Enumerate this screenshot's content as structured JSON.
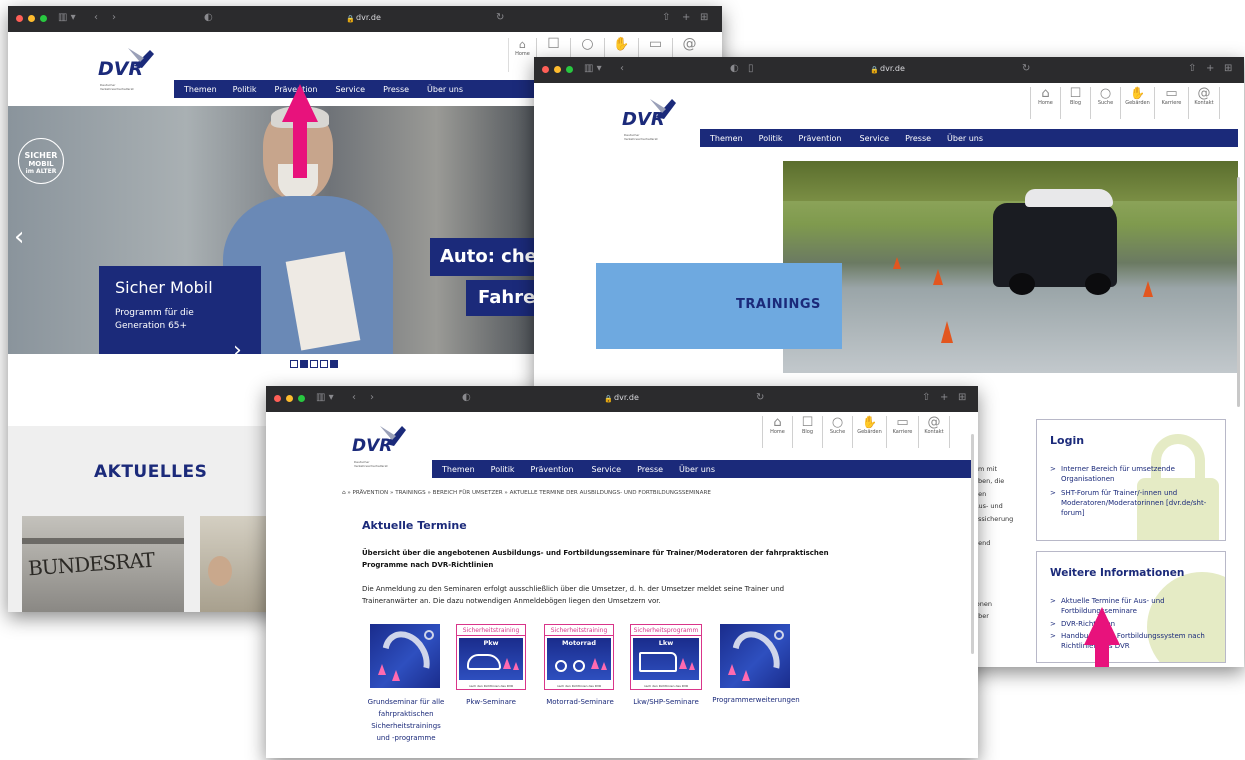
{
  "browser": {
    "url": "dvr.de"
  },
  "logo": {
    "text": "DVR",
    "sub1": "Deutscher",
    "sub2": "Verkehrssicherheitsrat"
  },
  "nav": [
    "Themen",
    "Politik",
    "Prävention",
    "Service",
    "Presse",
    "Über uns"
  ],
  "iconbar": [
    {
      "glyph": "⌂",
      "label": "Home",
      "icon": "home-icon"
    },
    {
      "glyph": "☐",
      "label": "Blog",
      "icon": "speech-bubble-icon"
    },
    {
      "glyph": "○",
      "label": "Suche",
      "icon": "search-icon"
    },
    {
      "glyph": "✋",
      "label": "Gebärden",
      "icon": "hand-icon"
    },
    {
      "glyph": "▭",
      "label": "Karriere",
      "icon": "briefcase-icon"
    },
    {
      "glyph": "@",
      "label": "Kontakt",
      "icon": "at-icon"
    }
  ],
  "win1": {
    "badge": [
      "SICHER",
      "MOBIL",
      "im ALTER"
    ],
    "teaser_title": "Sicher Mobil",
    "teaser_text1": "Programm für die",
    "teaser_text2": "Generation 65+",
    "headline1": "Auto: che",
    "headline2": "Fahre",
    "aktuelles": "AKTUELLES",
    "news_img_text": "BUNDESRAT"
  },
  "win2": {
    "trainings": "TRAININGS",
    "side_text": [
      "am mit",
      "aben, die",
      "hen",
      "Aus- und",
      "essicherung",
      "n",
      "gend",
      "",
      "",
      "ionen",
      "über"
    ],
    "login": {
      "title": "Login",
      "items": [
        "Interner Bereich für umsetzende Organisationen",
        "SHT-Forum für Trainer/-innen und Moderatoren/Moderatorinnen [dvr.de/sht-forum]"
      ]
    },
    "info": {
      "title": "Weitere Informationen",
      "items": [
        "Aktuelle Termine für Aus- und Fortbildungsseminare",
        "DVR-Richtlinien",
        "Handbuch- und Fortbildungssystem nach Richtlinien des DVR"
      ]
    }
  },
  "win3": {
    "breadcrumb": "⌂ » PRÄVENTION » TRAININGS » BEREICH FÜR UMSETZER » AKTUELLE TERMINE DER AUSBILDUNGS- UND FORTBILDUNGSSEMINARE",
    "title": "Aktuelle Termine",
    "lead1": "Übersicht über die angebotenen Ausbildungs- und Fortbildungsseminare für Trainer/Moderatoren der fahrpraktischen",
    "lead2": "Programme nach DVR-Richtlinien",
    "body1": "Die Anmeldung zu den Seminaren erfolgt ausschließlich über die Umsetzer, d. h. der Umsetzer meldet seine Trainer und",
    "body2": "Traineranwärter an. Die dazu notwendigen Anmeldebögen liegen den Umsetzern vor.",
    "tiles": [
      {
        "label": [
          "Grundseminar für alle",
          "fahrpraktischen",
          "Sicherheitstrainings",
          "und -programme"
        ]
      },
      {
        "head": "Sicherheitstraining",
        "sub": "Pkw",
        "foot": "nach den Richtlinien des DVR",
        "label": [
          "Pkw-Seminare"
        ]
      },
      {
        "head": "Sicherheitstraining",
        "sub": "Motorrad",
        "foot": "nach den Richtlinien des DVR",
        "label": [
          "Motorrad-Seminare"
        ]
      },
      {
        "head": "Sicherheitsprogramm",
        "sub": "Lkw",
        "foot": "nach den Richtlinien des DVR",
        "label": [
          "Lkw/SHP-Seminare"
        ]
      },
      {
        "label": [
          "Programmerweiterungen"
        ]
      }
    ]
  },
  "colors": {
    "brand_blue": "#1b2a7a",
    "light_blue": "#6ea9e0",
    "arrow_pink": "#e8127c",
    "tile_pink": "#d9358a"
  }
}
